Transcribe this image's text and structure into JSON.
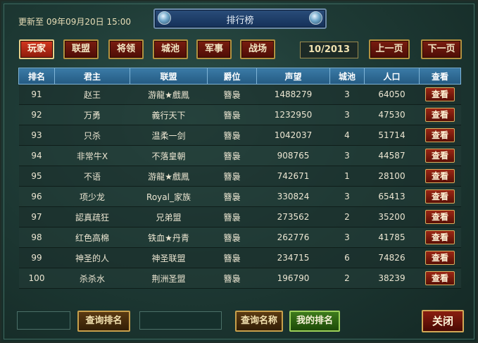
{
  "header": {
    "update_text": "更新至 09年09月20日 15:00",
    "title": "排行榜"
  },
  "tabs": [
    {
      "label": "玩家",
      "active": true
    },
    {
      "label": "联盟",
      "active": false
    },
    {
      "label": "将领",
      "active": false
    },
    {
      "label": "城池",
      "active": false
    },
    {
      "label": "军事",
      "active": false
    },
    {
      "label": "战场",
      "active": false
    }
  ],
  "pager": {
    "page_text": "10/2013",
    "prev_label": "上一页",
    "next_label": "下一页"
  },
  "table": {
    "columns": [
      "排名",
      "君主",
      "联盟",
      "爵位",
      "声望",
      "城池",
      "人口",
      "查看"
    ],
    "rows": [
      {
        "rank": "91",
        "lord": "赵王",
        "alliance": "游龍★戲鳳",
        "title": "簪裊",
        "prestige": "1488279",
        "cities": "3",
        "population": "64050",
        "view": "查看"
      },
      {
        "rank": "92",
        "lord": "万勇",
        "alliance": "義行天下",
        "title": "簪裊",
        "prestige": "1232950",
        "cities": "3",
        "population": "47530",
        "view": "查看"
      },
      {
        "rank": "93",
        "lord": "只杀",
        "alliance": "温柔一剑",
        "title": "簪裊",
        "prestige": "1042037",
        "cities": "4",
        "population": "51714",
        "view": "查看"
      },
      {
        "rank": "94",
        "lord": "非常牛X",
        "alliance": "不落皇朝",
        "title": "簪裊",
        "prestige": "908765",
        "cities": "3",
        "population": "44587",
        "view": "查看"
      },
      {
        "rank": "95",
        "lord": "不语",
        "alliance": "游龍★戲鳳",
        "title": "簪裊",
        "prestige": "742671",
        "cities": "1",
        "population": "28100",
        "view": "查看"
      },
      {
        "rank": "96",
        "lord": "项少龙",
        "alliance": "Royal_家族",
        "title": "簪裊",
        "prestige": "330824",
        "cities": "3",
        "population": "65413",
        "view": "查看"
      },
      {
        "rank": "97",
        "lord": "認真疏狂",
        "alliance": "兄弟盟",
        "title": "簪裊",
        "prestige": "273562",
        "cities": "2",
        "population": "35200",
        "view": "查看"
      },
      {
        "rank": "98",
        "lord": "红色高棉",
        "alliance": "铁血★丹青",
        "title": "簪裊",
        "prestige": "262776",
        "cities": "3",
        "population": "41785",
        "view": "查看"
      },
      {
        "rank": "99",
        "lord": "神圣的人",
        "alliance": "神圣联盟",
        "title": "簪裊",
        "prestige": "234715",
        "cities": "6",
        "population": "74826",
        "view": "查看"
      },
      {
        "rank": "100",
        "lord": "杀杀水",
        "alliance": "荆洲圣盟",
        "title": "簪裊",
        "prestige": "196790",
        "cities": "2",
        "population": "38239",
        "view": "查看"
      }
    ]
  },
  "footer": {
    "rank_query_input": "",
    "rank_query_label": "查询排名",
    "name_query_input": "",
    "name_query_label": "查询名称",
    "my_rank_label": "我的排名",
    "close_label": "关闭"
  }
}
